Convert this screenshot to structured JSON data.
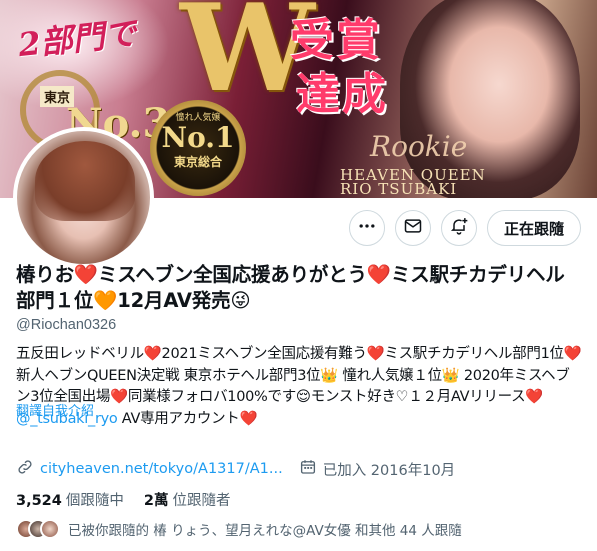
{
  "banner": {
    "left_text": "2部門で",
    "big_w": "W",
    "right_text_1": "受賞",
    "right_text_2": "達成",
    "tokyo_label": "東京",
    "no3": "No.3",
    "badge_small": "憧れ人気嬢",
    "badge_no1": "No.1",
    "badge_area": "東京総合",
    "rookie": "Rookie",
    "heaven_queen": "HEAVEN QUEEN",
    "name_romaji": "RIO TSUBAKI"
  },
  "actions": {
    "follow_label": "正在跟隨"
  },
  "profile": {
    "display_name": "椿りお❤️ミスヘブン全国応援ありがとう❤️ミス駅チカデリヘル部門１位🧡12月AV発売😜",
    "handle": "@Riochan0326",
    "bio_before_mention": "五反田レッドベリル❤️2021ミスヘブン全国応援有難う❤️ミス駅チカデリヘル部門1位❤️新人ヘブンQUEEN決定戦 東京ホテヘル部門3位👑 憧れ人気嬢１位👑 2020年ミスヘブン3位全国出場❤️同業様フォロバ100%です😌モンスト好き♡１２月AVリリース❤️",
    "bio_mention": "@_tsubaki_ryo",
    "bio_after_mention": " AV専用アカウント❤️",
    "translate_label": "翻譯自我介紹",
    "website": "cityheaven.net/tokyo/A1317/A1...",
    "joined": "已加入 2016年10月"
  },
  "stats": {
    "following_count": "3,524",
    "following_label": "個跟隨中",
    "followers_count": "2萬",
    "followers_label": "位跟隨者"
  },
  "followed_by": {
    "text": "已被你跟隨的 椿 りょう、望月えれな@AV女優 和其他 44 人跟隨"
  },
  "icons": {
    "more": "more-horizontal-icon",
    "message": "mail-icon",
    "notify": "bell-plus-icon",
    "link": "link-icon",
    "calendar": "calendar-icon"
  }
}
